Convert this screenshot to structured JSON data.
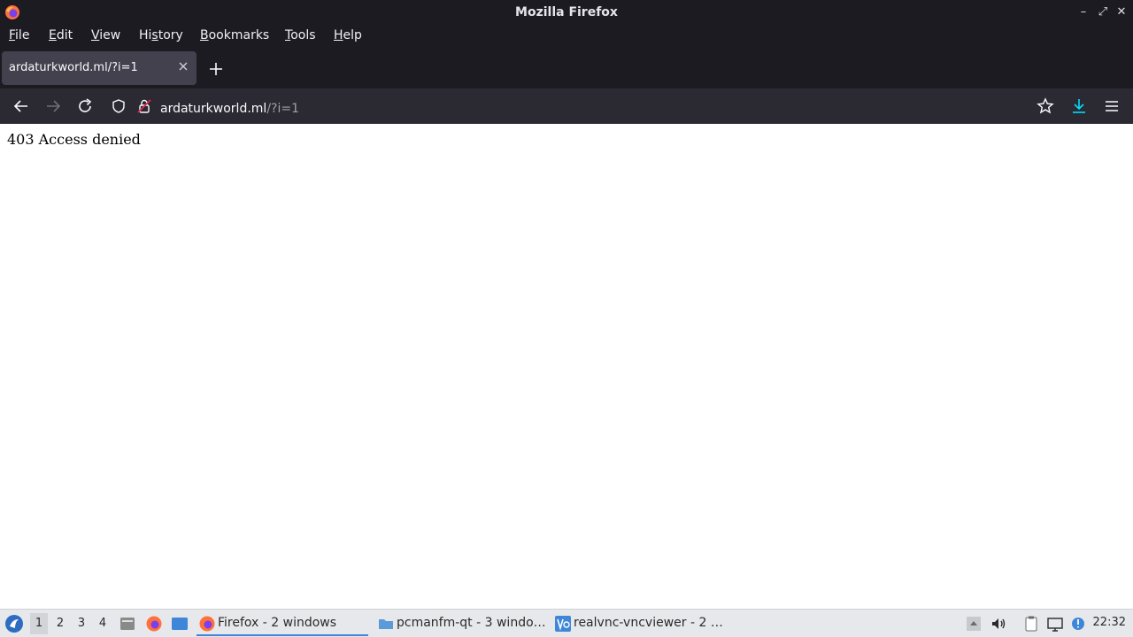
{
  "window": {
    "title": "Mozilla Firefox",
    "minimize_glyph": "–",
    "maximize_glyph": "⤢",
    "close_glyph": "✕"
  },
  "menu": {
    "items": [
      {
        "label_u": "F",
        "label_rest": "ile"
      },
      {
        "label_u": "E",
        "label_rest": "dit"
      },
      {
        "label_u": "V",
        "label_rest": "iew"
      },
      {
        "label_pre": "Hi",
        "label_u": "s",
        "label_rest": "tory"
      },
      {
        "label_u": "B",
        "label_rest": "ookmarks"
      },
      {
        "label_u": "T",
        "label_rest": "ools"
      },
      {
        "label_u": "H",
        "label_rest": "elp"
      }
    ]
  },
  "tabs": [
    {
      "title": "ardaturkworld.ml/?i=1"
    }
  ],
  "urlbar": {
    "host": "ardaturkworld.ml",
    "path": "/?i=1"
  },
  "page": {
    "message": "403 Access denied"
  },
  "taskbar": {
    "workspaces": [
      "1",
      "2",
      "3",
      "4"
    ],
    "active_workspace": "1",
    "tasks": [
      {
        "label": "Firefox - 2 windows",
        "icon": "firefox-icon"
      },
      {
        "label": "pcmanfm-qt - 3 windo…",
        "icon": "folder-icon"
      },
      {
        "label": "realvnc-vncviewer - 2 …",
        "icon": "vnc-icon"
      }
    ],
    "clock": "22:32"
  },
  "colors": {
    "chrome_bg": "#1c1b22",
    "toolbar_bg": "#2b2a33",
    "tab_active": "#42414d",
    "accent": "#00ddff",
    "taskbar_bg": "#e7e8eb"
  }
}
